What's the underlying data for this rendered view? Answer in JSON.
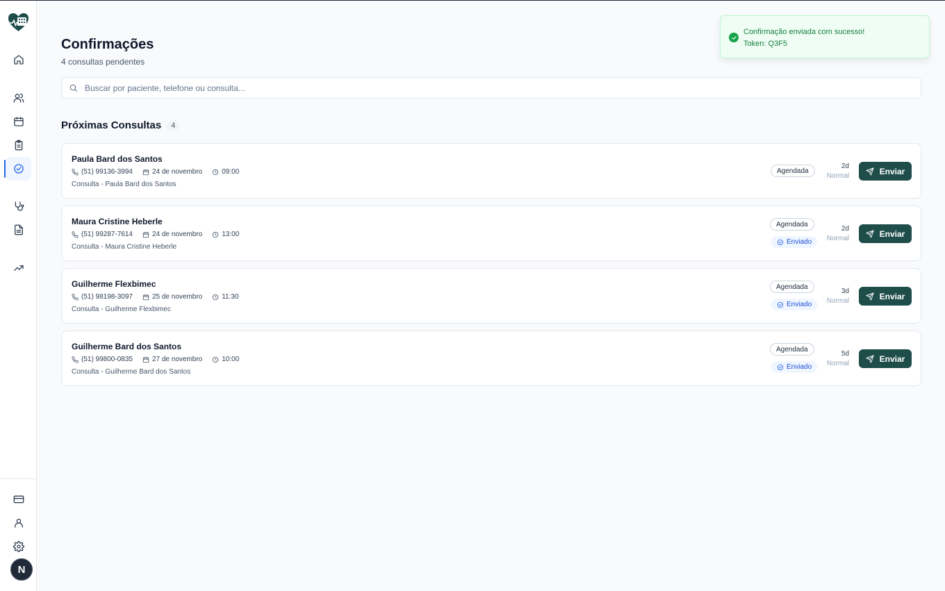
{
  "sidebar": {
    "logo": "heart-logo",
    "nav_items": [
      {
        "name": "home",
        "icon": "home-icon"
      },
      {
        "name": "patients",
        "icon": "users-icon"
      },
      {
        "name": "calendar",
        "icon": "calendar-icon"
      },
      {
        "name": "clipboard",
        "icon": "clipboard-icon"
      },
      {
        "name": "confirmations",
        "icon": "check-circle-icon",
        "active": true
      },
      {
        "name": "stethoscope",
        "icon": "stethoscope-icon"
      },
      {
        "name": "documents",
        "icon": "file-text-icon"
      },
      {
        "name": "analytics",
        "icon": "trending-up-icon"
      }
    ],
    "bottom_items": [
      {
        "name": "billing",
        "icon": "credit-card-icon"
      },
      {
        "name": "profile",
        "icon": "user-icon"
      },
      {
        "name": "settings",
        "icon": "gear-icon"
      }
    ],
    "avatar_letter": "N"
  },
  "header": {
    "title": "Confirmações",
    "subtitle": "4 consultas pendentes"
  },
  "search": {
    "placeholder": "Buscar por paciente, telefone ou consulta..."
  },
  "section": {
    "title": "Próximas Consultas",
    "count": "4"
  },
  "appointments": [
    {
      "name": "Paula Bard dos Santos",
      "phone": "(51) 99136-3994",
      "date": "24 de novembro",
      "time": "09:00",
      "description": "Consulta - Paula Bard dos Santos",
      "status": "Agendada",
      "sent": false,
      "sent_label": "",
      "days": "2d",
      "priority": "Normal",
      "button": "Enviar"
    },
    {
      "name": "Maura Cristine Heberle",
      "phone": "(51) 99287-7614",
      "date": "24 de novembro",
      "time": "13:00",
      "description": "Consulta - Maura Cristine Heberle",
      "status": "Agendada",
      "sent": true,
      "sent_label": "Enviado",
      "days": "2d",
      "priority": "Normal",
      "button": "Enviar"
    },
    {
      "name": "Guilherme Flexbimec",
      "phone": "(51) 98198-3097",
      "date": "25 de novembro",
      "time": "11:30",
      "description": "Consulta - Guilherme Flexbimec",
      "status": "Agendada",
      "sent": true,
      "sent_label": "Enviado",
      "days": "3d",
      "priority": "Normal",
      "button": "Enviar"
    },
    {
      "name": "Guilherme Bard dos Santos",
      "phone": "(51) 99800-0835",
      "date": "27 de novembro",
      "time": "10:00",
      "description": "Consulta - Guilherme Bard dos Santos",
      "status": "Agendada",
      "sent": true,
      "sent_label": "Enviado",
      "days": "5d",
      "priority": "Normal",
      "button": "Enviar"
    }
  ],
  "toast": {
    "title": "Confirmação enviada com sucesso!",
    "token": "Token: Q3F5"
  },
  "colors": {
    "accent": "#2563eb",
    "primary_button": "#1e4d4a",
    "success": "#16a34a"
  }
}
